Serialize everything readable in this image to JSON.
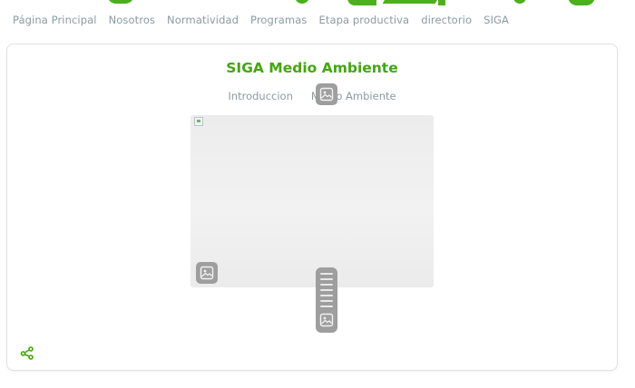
{
  "nav": {
    "items": [
      "Página Principal",
      "Nosotros",
      "Normatividad",
      "Programas",
      "Etapa productiva",
      "directorio",
      "SIGA"
    ]
  },
  "card": {
    "title": "SIGA Medio Ambiente",
    "tabs": [
      "Introduccion",
      "Medio Ambiente"
    ]
  },
  "colors": {
    "accent": "#43a60f",
    "nav_text": "#8a9aa4",
    "placeholder": "#9e9e9e"
  },
  "icons": {
    "share": "share-icon",
    "image_placeholder": "image-placeholder-icon",
    "broken_image": "broken-image-icon"
  }
}
